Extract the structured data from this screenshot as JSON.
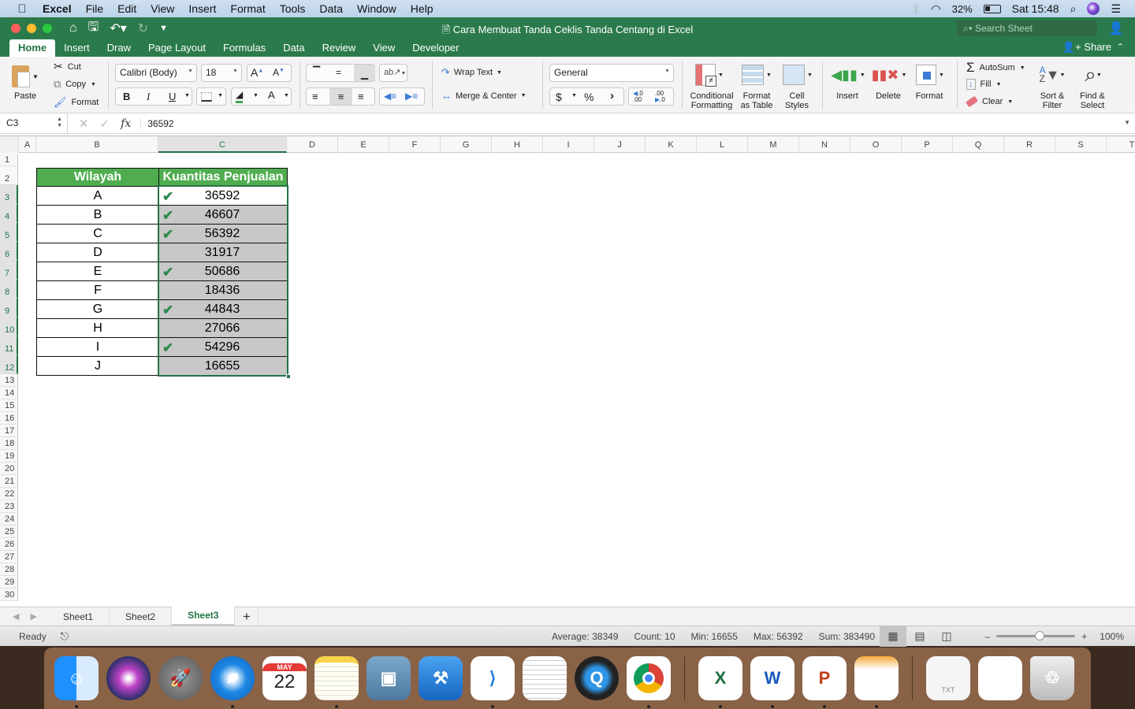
{
  "menubar": {
    "app_name": "Excel",
    "items": [
      "File",
      "Edit",
      "View",
      "Insert",
      "Format",
      "Tools",
      "Data",
      "Window",
      "Help"
    ],
    "battery": "32%",
    "clock": "Sat 15:48"
  },
  "titlebar": {
    "document_title": "Cara Membuat Tanda Ceklis Tanda Centang di Excel",
    "search_placeholder": "Search Sheet"
  },
  "ribbon_tabs": {
    "tabs": [
      "Home",
      "Insert",
      "Draw",
      "Page Layout",
      "Formulas",
      "Data",
      "Review",
      "View",
      "Developer"
    ],
    "active": "Home",
    "share_label": "Share"
  },
  "ribbon": {
    "clipboard": {
      "paste": "Paste",
      "cut": "Cut",
      "copy": "Copy",
      "format": "Format"
    },
    "font": {
      "name": "Calibri (Body)",
      "size": "18",
      "bold": "B",
      "italic": "I",
      "underline": "U"
    },
    "alignment": {
      "wrap_text": "Wrap Text",
      "merge_center": "Merge & Center"
    },
    "number": {
      "format": "General",
      "currency": "$",
      "percent": "%",
      "comma": "’"
    },
    "styles": {
      "conditional_formatting": "Conditional Formatting",
      "format_as_table": "Format as Table",
      "cell_styles": "Cell Styles"
    },
    "cells": {
      "insert": "Insert",
      "delete": "Delete",
      "format": "Format"
    },
    "editing": {
      "autosum": "AutoSum",
      "fill": "Fill",
      "clear": "Clear",
      "sort_filter": "Sort & Filter",
      "find_select": "Find & Select"
    }
  },
  "formula_bar": {
    "name_box": "C3",
    "fx": "fx",
    "value": "36592"
  },
  "grid": {
    "columns": [
      "A",
      "B",
      "C",
      "D",
      "E",
      "F",
      "G",
      "H",
      "I",
      "J",
      "K",
      "L",
      "M",
      "N",
      "O",
      "P",
      "Q",
      "R",
      "S",
      "T"
    ],
    "selected_column": "C",
    "rows": [
      "1",
      "2",
      "3",
      "4",
      "5",
      "6",
      "7",
      "8",
      "9",
      "10",
      "11",
      "12",
      "13",
      "14",
      "15",
      "16",
      "17",
      "18",
      "19",
      "20",
      "21",
      "22",
      "23",
      "24",
      "25",
      "26",
      "27",
      "28",
      "29",
      "30"
    ],
    "table": {
      "headers": [
        "Wilayah",
        "Kuantitas Penjualan"
      ],
      "rows": [
        {
          "wilayah": "A",
          "qty": "36592",
          "check": true
        },
        {
          "wilayah": "B",
          "qty": "46607",
          "check": true
        },
        {
          "wilayah": "C",
          "qty": "56392",
          "check": true
        },
        {
          "wilayah": "D",
          "qty": "31917",
          "check": false
        },
        {
          "wilayah": "E",
          "qty": "50686",
          "check": true
        },
        {
          "wilayah": "F",
          "qty": "18436",
          "check": false
        },
        {
          "wilayah": "G",
          "qty": "44843",
          "check": true
        },
        {
          "wilayah": "H",
          "qty": "27066",
          "check": false
        },
        {
          "wilayah": "I",
          "qty": "54296",
          "check": true
        },
        {
          "wilayah": "J",
          "qty": "16655",
          "check": false
        }
      ]
    },
    "header_color": "#4fad4f",
    "check_color": "#2e8b4e"
  },
  "sheets": {
    "tabs": [
      "Sheet1",
      "Sheet2",
      "Sheet3"
    ],
    "active": "Sheet3"
  },
  "status": {
    "mode": "Ready",
    "average": "Average: 38349",
    "count": "Count: 10",
    "min": "Min: 16655",
    "max": "Max: 56392",
    "sum": "Sum: 383490",
    "zoom": "100%",
    "zoom_value": 100
  },
  "dock": {
    "apps": [
      {
        "name": "Finder",
        "icon": "finder-icon",
        "running": true
      },
      {
        "name": "Siri",
        "icon": "siri-icon",
        "running": false
      },
      {
        "name": "Launchpad",
        "icon": "launchpad-icon",
        "running": false
      },
      {
        "name": "Safari",
        "icon": "safari-icon",
        "running": true
      },
      {
        "name": "Calendar",
        "icon": "calendar-icon",
        "running": false,
        "month": "MAY",
        "day": "22"
      },
      {
        "name": "Notes",
        "icon": "notes-icon",
        "running": true
      },
      {
        "name": "Preview",
        "icon": "preview-icon",
        "running": false
      },
      {
        "name": "Xcode",
        "icon": "xcode-icon",
        "running": false
      },
      {
        "name": "Visual Studio Code",
        "icon": "vscode-icon",
        "running": true
      },
      {
        "name": "TextEdit",
        "icon": "textedit-icon",
        "running": false
      },
      {
        "name": "QuickTime Player",
        "icon": "quicktime-icon",
        "running": false
      },
      {
        "name": "Chrome",
        "icon": "chrome-icon",
        "running": true
      },
      {
        "name": "Excel",
        "icon": "excel-icon",
        "running": true
      },
      {
        "name": "Word",
        "icon": "word-icon",
        "running": true
      },
      {
        "name": "PowerPoint",
        "icon": "powerpoint-icon",
        "running": true
      },
      {
        "name": "Pages",
        "icon": "pages-icon",
        "running": true
      },
      {
        "name": "TXT document",
        "icon": "txt-file-icon",
        "running": false,
        "label": "TXT"
      },
      {
        "name": "Documents stack",
        "icon": "documents-stack-icon",
        "running": false
      },
      {
        "name": "Trash",
        "icon": "trash-icon",
        "running": false
      }
    ]
  }
}
